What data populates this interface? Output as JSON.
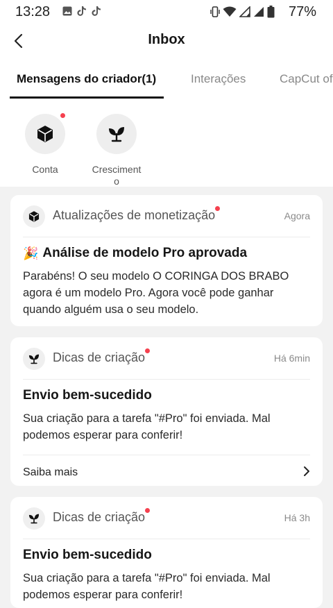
{
  "status_bar": {
    "time": "13:28",
    "battery_percent": "77%",
    "left_icons": [
      "gallery-icon",
      "tiktok-icon",
      "tiktok-icon"
    ],
    "right_icons": [
      "vibrate-icon",
      "wifi-icon",
      "signal-icon",
      "signal-icon",
      "battery-icon"
    ]
  },
  "header": {
    "title": "Inbox",
    "back_icon": "chevron-left-icon"
  },
  "tabs": [
    {
      "label": "Mensagens do criador(1)",
      "active": true
    },
    {
      "label": "Interações",
      "active": false
    },
    {
      "label": "CapCut oficial",
      "active": false
    }
  ],
  "categories": [
    {
      "label": "Conta",
      "icon": "cube-icon",
      "unread": true
    },
    {
      "label": "Cresciment\no",
      "icon": "sprout-icon",
      "unread": false
    }
  ],
  "cards": [
    {
      "category": "Atualizações de monetização",
      "icon": "cube-icon",
      "unread": true,
      "time": "Agora",
      "emoji": "🎉",
      "title": "Análise de modelo Pro aprovada",
      "text": "Parabéns! O seu modelo O CORINGA DOS BRABO agora é um modelo Pro. Agora você pode ganhar quando alguém usa o seu modelo."
    },
    {
      "category": "Dicas de criação",
      "icon": "sprout-icon",
      "unread": true,
      "time": "Há 6min",
      "title": "Envio bem-sucedido",
      "text": "Sua criação para a tarefa \"#Pro\" foi enviada. Mal podemos esperar para conferir!",
      "link": "Saiba mais"
    },
    {
      "category": "Dicas de criação",
      "icon": "sprout-icon",
      "unread": true,
      "time": "Há 3h",
      "title": "Envio bem-sucedido",
      "text": "Sua criação para a tarefa \"#Pro\" foi enviada. Mal podemos esperar para conferir!"
    }
  ],
  "colors": {
    "accent_dot": "#f5414f",
    "background": "#f2f2f2"
  }
}
